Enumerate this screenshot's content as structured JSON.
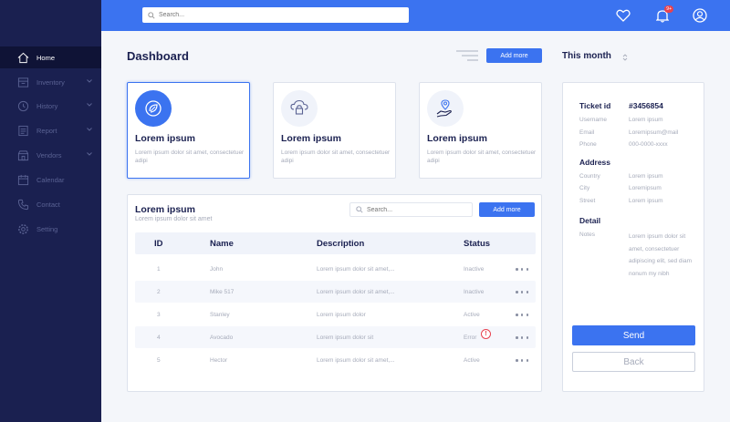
{
  "search": {
    "placeholder": "Search..."
  },
  "header": {
    "notification_count": "9+"
  },
  "sidebar": {
    "items": [
      {
        "label": "Home",
        "icon": "home-icon",
        "active": true,
        "has_chevron": false
      },
      {
        "label": "Inventory",
        "icon": "inventory-icon",
        "active": false,
        "has_chevron": true
      },
      {
        "label": "History",
        "icon": "history-icon",
        "active": false,
        "has_chevron": true
      },
      {
        "label": "Report",
        "icon": "report-icon",
        "active": false,
        "has_chevron": true
      },
      {
        "label": "Vendors",
        "icon": "vendors-icon",
        "active": false,
        "has_chevron": true
      },
      {
        "label": "Calendar",
        "icon": "calendar-icon",
        "active": false,
        "has_chevron": false
      },
      {
        "label": "Contact",
        "icon": "phone-icon",
        "active": false,
        "has_chevron": false
      },
      {
        "label": "Setting",
        "icon": "gear-icon",
        "active": false,
        "has_chevron": false
      }
    ]
  },
  "main": {
    "title": "Dashboard",
    "add_more_label": "Add more",
    "period_label": "This month"
  },
  "cards": [
    {
      "title": "Lorem ipsum",
      "desc": "Lorem ipsum dolor sit amet, consectetuer adipi",
      "icon": "leaf-globe-icon",
      "selected": true
    },
    {
      "title": "Lorem ipsum",
      "desc": "Lorem ipsum dolor sit amet, consectetuer adipi",
      "icon": "cloud-lock-icon",
      "selected": false
    },
    {
      "title": "Lorem ipsum",
      "desc": "Lorem ipsum dolor sit amet, consectetuer adipi",
      "icon": "hand-location-icon",
      "selected": false
    }
  ],
  "table": {
    "title": "Lorem ipsum",
    "subtitle": "Lorem ipsum dolor sit amet",
    "search_placeholder": "Search...",
    "add_more_label": "Add more",
    "columns": [
      "ID",
      "Name",
      "Description",
      "Status"
    ],
    "rows": [
      {
        "id": "1",
        "name": "John",
        "desc": "Lorem ipsum dolor sit amet,...",
        "status": "Inactive",
        "error": false
      },
      {
        "id": "2",
        "name": "Mike 517",
        "desc": "Lorem ipsum dolor sit amet,...",
        "status": "Inactive",
        "error": false
      },
      {
        "id": "3",
        "name": "Stanley",
        "desc": "Lorem ipsum dolor",
        "status": "Active",
        "error": false
      },
      {
        "id": "4",
        "name": "Avocado",
        "desc": "Lorem ipsum dolor sit",
        "status": "Error",
        "error": true
      },
      {
        "id": "5",
        "name": "Hector",
        "desc": "Lorem ipsum dolor sit amet,...",
        "status": "Active",
        "error": false
      }
    ]
  },
  "detail": {
    "ticket_label": "Ticket id",
    "ticket_value": "#3456854",
    "fields": [
      {
        "label": "Username",
        "value": "Lorem ipsum"
      },
      {
        "label": "Email",
        "value": "Loremipsum@mail"
      },
      {
        "label": "Phone",
        "value": "000-0000-xxxx"
      }
    ],
    "address_heading": "Address",
    "address_fields": [
      {
        "label": "Country",
        "value": "Lorem ipsum"
      },
      {
        "label": "City",
        "value": "Loremipsum"
      },
      {
        "label": "Street",
        "value": "Lorem ipsum"
      }
    ],
    "detail_heading": "Detail",
    "notes_label": "Notes",
    "notes_value": "Lorem ipsum dolor sit amet, consectetuer adipiscing elit, sed diam nonum my nibh",
    "send_label": "Send",
    "back_label": "Back"
  },
  "colors": {
    "accent": "#3b73f0",
    "sidebar": "#1a2050",
    "error": "#e8424f"
  }
}
